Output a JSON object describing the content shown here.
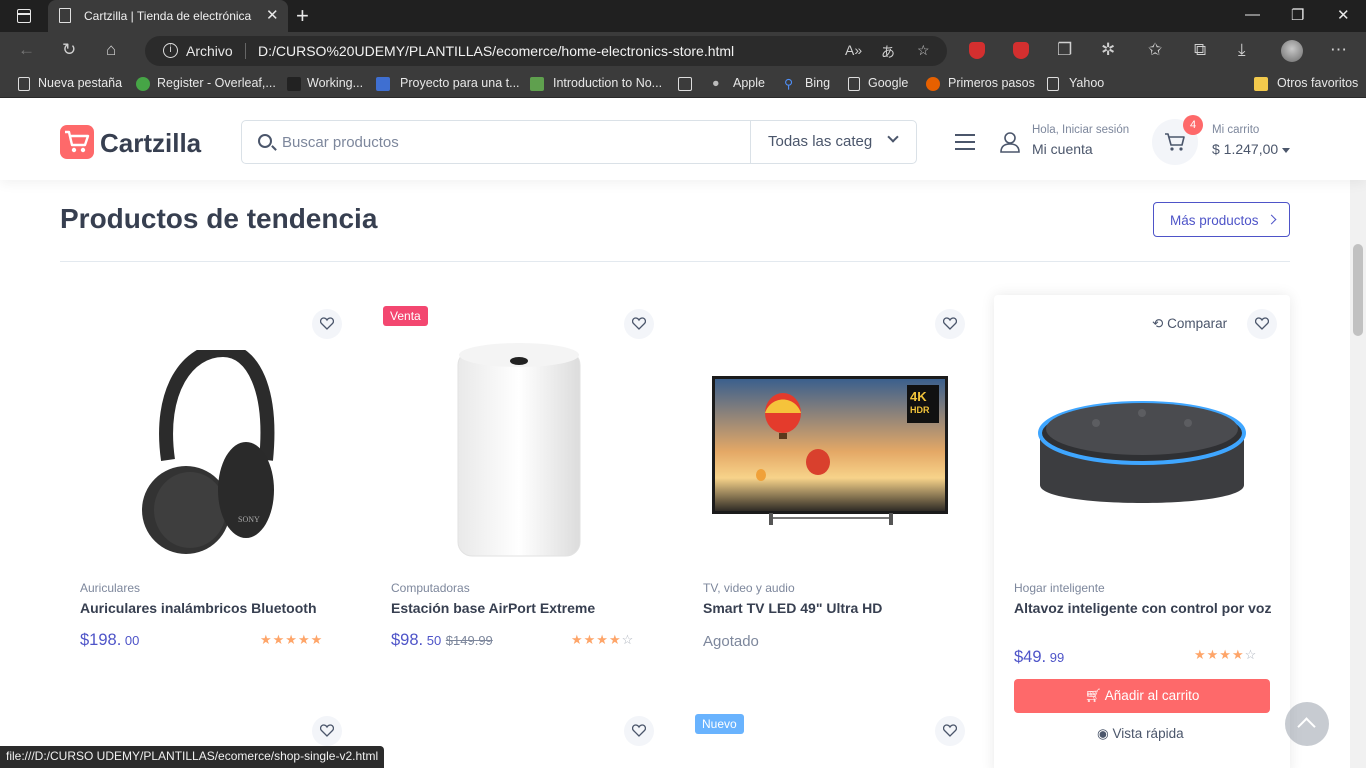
{
  "browser": {
    "tab_title": "Cartzilla | Tienda de electrónica",
    "address_label": "Archivo",
    "url": "D:/CURSO%20UDEMY/PLANTILLAS/ecomerce/home-electronics-store.html",
    "bookmarks": [
      "Nueva pestaña",
      "Register - Overleaf,...",
      "Working...",
      "Proyecto para una t...",
      "Introduction to No...",
      "Apple",
      "Bing",
      "Google",
      "Primeros pasos",
      "Yahoo",
      "Otros favoritos"
    ],
    "status_url": "file:///D:/CURSO UDEMY/PLANTILLAS/ecomerce/shop-single-v2.html"
  },
  "header": {
    "logo": "Cartzilla",
    "search_placeholder": "Buscar productos",
    "category_select": "Todas las categorías",
    "account_small": "Hola, Iniciar sesión",
    "account_big": "Mi cuenta",
    "cart_count": "4",
    "cart_small": "Mi carrito",
    "cart_total": "$ 1.247,00"
  },
  "section": {
    "title": "Productos de tendencia",
    "more_button": "Más productos"
  },
  "products": [
    {
      "category": "Auriculares",
      "title": "Auriculares inalámbricos Bluetooth",
      "price": "$198.",
      "cents": " 00",
      "old_price": "",
      "badge": "",
      "rating": 5,
      "stars": "★★★★★"
    },
    {
      "category": "Computadoras",
      "title": "Estación base AirPort Extreme",
      "price": "$98.",
      "cents": " 50",
      "old_price": "$149.99",
      "badge": "Venta",
      "rating": 4,
      "stars": "★★★★",
      "stars_off": "☆"
    },
    {
      "category": "TV, video y audio",
      "title": "Smart TV LED 49\" Ultra HD",
      "status": "Agotado",
      "badge": ""
    },
    {
      "category": "Hogar inteligente",
      "title": "Altavoz inteligente con control por voz",
      "price": "$49.",
      "cents": " 99",
      "rating": 4,
      "stars": "★★★★",
      "stars_off": "☆",
      "compare": "Comparar",
      "add_to_cart": "Añadir al carrito",
      "quick_view": "Vista rápida"
    }
  ],
  "next_row_badge": "Nuevo",
  "colors": {
    "accent": "#fe696a",
    "primary": "#4e54c8",
    "star": "#fea569",
    "sale_badge": "#f34770",
    "new_badge": "#69b3fe"
  }
}
